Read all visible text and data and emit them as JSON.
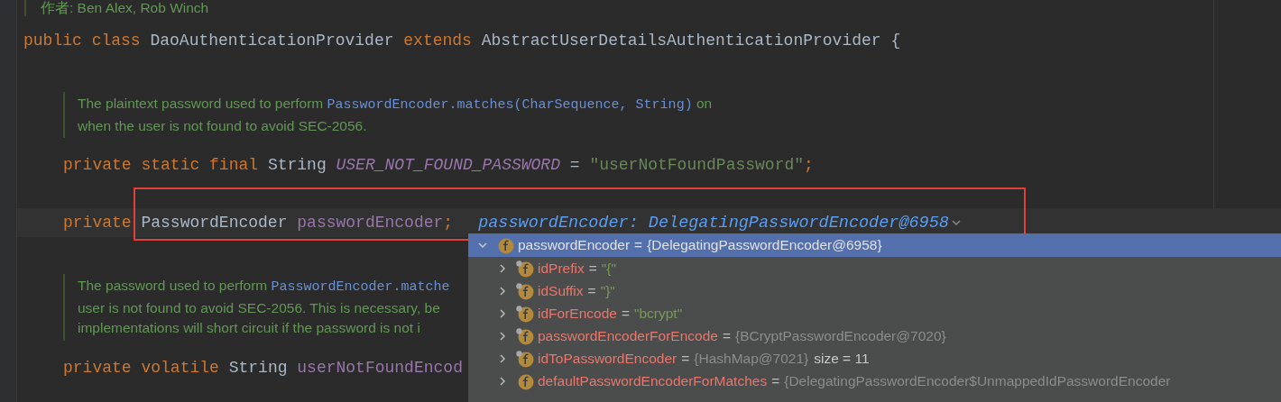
{
  "author_doc": {
    "text": "作者: Ben Alex, Rob Winch"
  },
  "class_declaration": {
    "tokens": [
      {
        "text": "public",
        "kind": "keyword"
      },
      {
        "text": "class",
        "kind": "keyword"
      },
      {
        "text": "DaoAuthenticationProvider",
        "kind": "type"
      },
      {
        "text": "extends",
        "kind": "keyword"
      },
      {
        "text": "AbstractUserDetailsAuthenticationProvider",
        "kind": "type"
      },
      {
        "text": "{",
        "kind": "brace"
      }
    ],
    "members": [
      {
        "kind": "doc",
        "lines": [
          [
            {
              "text": "The plaintext password used to perform ",
              "kind": "prose"
            },
            {
              "text": "PasswordEncoder.matches(CharSequence, String)",
              "kind": "code"
            },
            {
              "text": " on",
              "kind": "prose"
            }
          ],
          [
            {
              "text": "when the user is not found to avoid SEC-2056.",
              "kind": "prose"
            }
          ]
        ]
      },
      {
        "kind": "field",
        "current": false,
        "tokens": [
          {
            "text": "private",
            "kind": "keyword"
          },
          {
            "text": "static",
            "kind": "keyword"
          },
          {
            "text": "final",
            "kind": "keyword"
          },
          {
            "text": "String",
            "kind": "type"
          },
          {
            "text": "USER_NOT_FOUND_PASSWORD",
            "kind": "constant"
          },
          {
            "text": "=",
            "kind": "operator"
          },
          {
            "text": "\"userNotFoundPassword\"",
            "kind": "string"
          },
          {
            "text": ";",
            "kind": "punct"
          }
        ]
      },
      {
        "kind": "field",
        "current": true,
        "tokens": [
          {
            "text": "private",
            "kind": "keyword"
          },
          {
            "text": "PasswordEncoder",
            "kind": "type"
          },
          {
            "text": "passwordEncoder",
            "kind": "field"
          },
          {
            "text": ";",
            "kind": "punct"
          }
        ],
        "inline_hint": "passwordEncoder: DelegatingPasswordEncoder@6958"
      },
      {
        "kind": "doc",
        "lines": [
          [
            {
              "text": "The password used to perform ",
              "kind": "prose"
            },
            {
              "text": "PasswordEncoder.matche",
              "kind": "code"
            }
          ],
          [
            {
              "text": "user is not found to avoid SEC-2056. This is necessary, be",
              "kind": "prose"
            }
          ],
          [
            {
              "text": "implementations will short circuit if the password is not i",
              "kind": "prose"
            }
          ]
        ]
      },
      {
        "kind": "field",
        "current": false,
        "tokens": [
          {
            "text": "private",
            "kind": "keyword"
          },
          {
            "text": "volatile",
            "kind": "keyword"
          },
          {
            "text": "String",
            "kind": "type"
          },
          {
            "text": "userNotFoundEncod",
            "kind": "field"
          }
        ]
      }
    ]
  },
  "debugger_popup": {
    "root": {
      "name": "passwordEncoder",
      "operator": "=",
      "value": "{DelegatingPasswordEncoder@6958}",
      "expanded": true,
      "selected": true,
      "children": [
        {
          "name": "idPrefix",
          "operator": "=",
          "value": "\"{\"",
          "kind": "string",
          "final": true,
          "expanded": false,
          "selected": false
        },
        {
          "name": "idSuffix",
          "operator": "=",
          "value": "\"}\"",
          "kind": "string",
          "final": true,
          "expanded": false,
          "selected": false
        },
        {
          "name": "idForEncode",
          "operator": "=",
          "value": "\"bcrypt\"",
          "kind": "string",
          "final": true,
          "expanded": false,
          "selected": false
        },
        {
          "name": "passwordEncoderForEncode",
          "operator": "=",
          "value": "{BCryptPasswordEncoder@7020}",
          "kind": "object",
          "final": true,
          "expanded": false,
          "selected": false
        },
        {
          "name": "idToPasswordEncoder",
          "operator": "=",
          "value": "{HashMap@7021}",
          "kind": "object",
          "extra": "size = 11",
          "final": true,
          "expanded": false,
          "selected": false
        },
        {
          "name": "defaultPasswordEncoderForMatches",
          "operator": "=",
          "value": "{DelegatingPasswordEncoder$UnmappedIdPasswordEncoder",
          "kind": "object",
          "final": false,
          "expanded": false,
          "selected": false
        }
      ]
    }
  }
}
